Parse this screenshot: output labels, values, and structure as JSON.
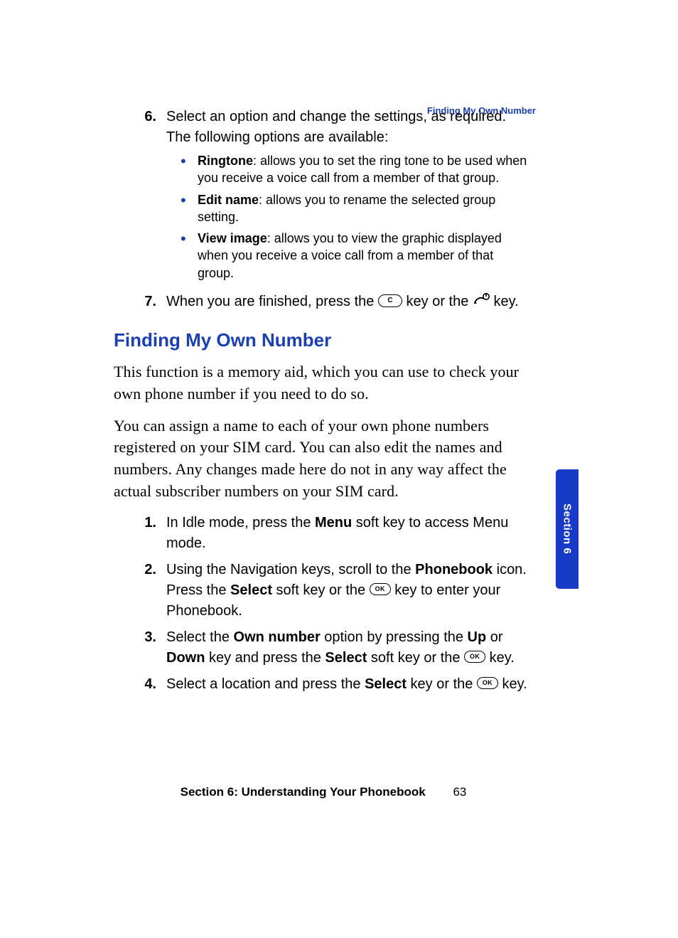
{
  "running_head": "Finding My Own Number",
  "step6": {
    "num": "6.",
    "text_a": "Select an option and change the settings, as required. The following options are available:",
    "bullets": [
      {
        "bold": "Ringtone",
        "rest": ": allows you to set the ring tone to be used when you receive a voice call from a member of that group."
      },
      {
        "bold": "Edit name",
        "rest": ": allows you to rename the selected group setting."
      },
      {
        "bold": "View image",
        "rest": ": allows you to view the graphic displayed when you receive a voice call from a member of that group."
      }
    ]
  },
  "step7": {
    "num": "7.",
    "pre": "When you are finished, press the ",
    "mid": " key or the ",
    "post": " key."
  },
  "heading": "Finding My Own Number",
  "para1": "This function is a memory aid, which you can use to check your own phone number if you need to do so.",
  "para2": "You can assign a name to each of your own phone numbers registered on your SIM card. You can also edit the names and numbers. Any changes made here do not in any way affect the actual subscriber numbers on your SIM card.",
  "steps2": [
    {
      "num": "1.",
      "parts": [
        {
          "t": "In Idle mode, press the "
        },
        {
          "b": "Menu"
        },
        {
          "t": " soft key to access Menu mode."
        }
      ]
    },
    {
      "num": "2.",
      "parts": [
        {
          "t": "Using the Navigation keys, scroll to the "
        },
        {
          "b": "Phonebook"
        },
        {
          "t": " icon. Press the "
        },
        {
          "b": "Select"
        },
        {
          "t": " soft key or the "
        },
        {
          "ok": true
        },
        {
          "t": " key to enter your Phonebook."
        }
      ]
    },
    {
      "num": "3.",
      "parts": [
        {
          "t": "Select the "
        },
        {
          "b": "Own number"
        },
        {
          "t": " option by pressing the "
        },
        {
          "b": "Up"
        },
        {
          "t": " or "
        },
        {
          "b": "Down"
        },
        {
          "t": " key and press the "
        },
        {
          "b": "Select"
        },
        {
          "t": " soft key or the "
        },
        {
          "ok": true
        },
        {
          "t": " key."
        }
      ]
    },
    {
      "num": "4.",
      "parts": [
        {
          "t": "Select a location and press the "
        },
        {
          "b": "Select"
        },
        {
          "t": " key or the "
        },
        {
          "ok": true
        },
        {
          "t": " key."
        }
      ]
    }
  ],
  "key_c_label": "C",
  "key_ok_label": "OK",
  "section_tab": "Section 6",
  "footer_title": "Section 6: Understanding Your Phonebook",
  "footer_page": "63"
}
